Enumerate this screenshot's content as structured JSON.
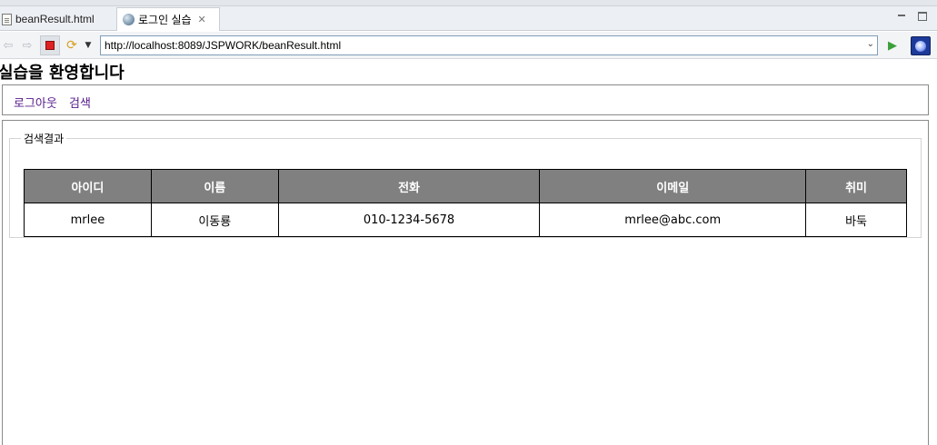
{
  "tabs": [
    {
      "label": "beanResult.html",
      "icon": "document-icon"
    },
    {
      "label": "로그인 실습",
      "icon": "globe-icon",
      "close": "✕"
    }
  ],
  "navbar": {
    "url": "http://localhost:8089/JSPWORK/beanResult.html"
  },
  "page": {
    "heading": "실습을 환영합니다",
    "menu": {
      "logout": "로그아웃",
      "search": "검색"
    },
    "legend": "검색결과",
    "table": {
      "headers": [
        "아이디",
        "이름",
        "전화",
        "이메일",
        "취미"
      ],
      "rows": [
        [
          "mrlee",
          "이동룡",
          "010-1234-5678",
          "mrlee@abc.com",
          "바둑"
        ]
      ]
    }
  },
  "colors": {
    "header_bg": "#808080",
    "link": "#551a8b",
    "stop": "#dd2222",
    "go": "#3aa03a"
  }
}
